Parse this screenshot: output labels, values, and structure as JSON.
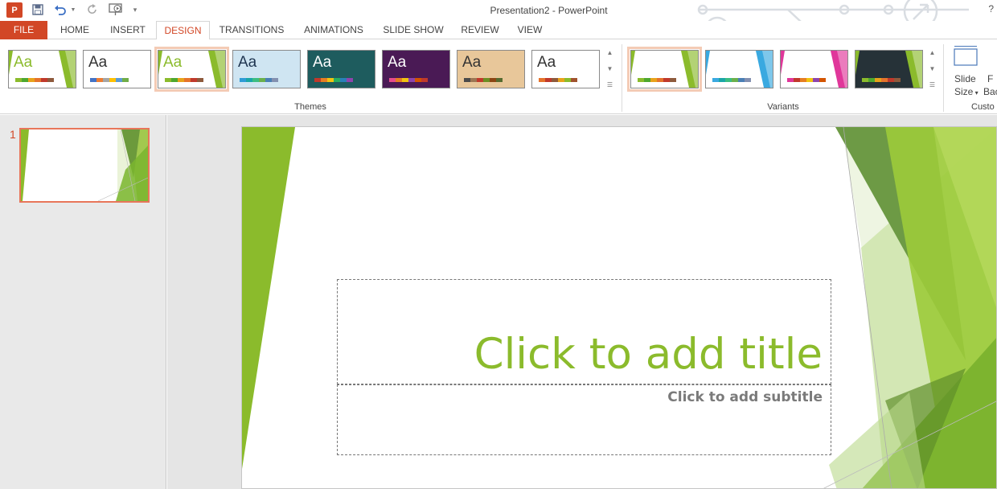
{
  "window": {
    "title": "Presentation2 - PowerPoint",
    "help": "?"
  },
  "qat": {
    "logo": "P"
  },
  "tabs": [
    {
      "label": "FILE"
    },
    {
      "label": "HOME"
    },
    {
      "label": "INSERT"
    },
    {
      "label": "DESIGN"
    },
    {
      "label": "TRANSITIONS"
    },
    {
      "label": "ANIMATIONS"
    },
    {
      "label": "SLIDE SHOW"
    },
    {
      "label": "REVIEW"
    },
    {
      "label": "VIEW"
    }
  ],
  "themes": {
    "label": "Themes",
    "items": [
      {
        "aa": "Aa",
        "aa_color": "#8bbb2c",
        "bg": "#ffffff",
        "accent": "#8bbb2c",
        "bars": [
          "#8bbb2c",
          "#4ea72e",
          "#e8a21a",
          "#e5732b",
          "#c0392b",
          "#8e5a3c"
        ]
      },
      {
        "aa": "Aa",
        "aa_color": "#333333",
        "bg": "#ffffff",
        "accent": "",
        "bars": [
          "#4472c4",
          "#ed7d31",
          "#a5a5a5",
          "#ffc000",
          "#5b9bd5",
          "#70ad47"
        ]
      },
      {
        "aa": "Aa",
        "aa_color": "#8bbb2c",
        "bg": "#ffffff",
        "accent": "#8bbb2c",
        "bars": [
          "#8bbb2c",
          "#4ea72e",
          "#e8a21a",
          "#e5732b",
          "#c0392b",
          "#8e5a3c"
        ]
      },
      {
        "aa": "Aa",
        "aa_color": "#1f3550",
        "bg": "#cfe5f2",
        "accent": "",
        "bars": [
          "#2e9bd6",
          "#1aa6a6",
          "#3cbd82",
          "#6ab04c",
          "#4a7fb5",
          "#8390b0"
        ]
      },
      {
        "aa": "Aa",
        "aa_color": "#ffffff",
        "bg": "#1e5c5e",
        "accent": "",
        "bars": [
          "#c0392b",
          "#e67e22",
          "#f1c40f",
          "#27ae60",
          "#2980b9",
          "#8e44ad"
        ]
      },
      {
        "aa": "Aa",
        "aa_color": "#ffffff",
        "bg": "#4a1a55",
        "accent": "",
        "bars": [
          "#e74c8c",
          "#e67e22",
          "#f1c40f",
          "#8e44ad",
          "#d35400",
          "#c0392b"
        ]
      },
      {
        "aa": "Aa",
        "aa_color": "#333333",
        "bg": "#e8c79a",
        "accent": "",
        "bars": [
          "#4a4a4a",
          "#9b7653",
          "#c0392b",
          "#6b8e23",
          "#8b4513",
          "#556b2f"
        ]
      },
      {
        "aa": "Aa",
        "aa_color": "#333333",
        "bg": "#ffffff",
        "accent": "",
        "bars": [
          "#e5732b",
          "#c0392b",
          "#8e5a3c",
          "#e8a21a",
          "#8bbb2c",
          "#a0522d"
        ]
      }
    ]
  },
  "variants": {
    "label": "Variants",
    "items": [
      {
        "bg": "#ffffff",
        "accent": "#8bbb2c",
        "bars": [
          "#8bbb2c",
          "#4ea72e",
          "#e8a21a",
          "#e5732b",
          "#c0392b",
          "#8e5a3c"
        ]
      },
      {
        "bg": "#ffffff",
        "accent": "#3aa9e0",
        "bars": [
          "#3aa9e0",
          "#1aa6a6",
          "#3cbd82",
          "#6ab04c",
          "#4a7fb5",
          "#8390b0"
        ]
      },
      {
        "bg": "#ffffff",
        "accent": "#e0379a",
        "bars": [
          "#e0379a",
          "#c0392b",
          "#e67e22",
          "#f1c40f",
          "#8e44ad",
          "#d35400"
        ]
      },
      {
        "bg": "#263238",
        "accent": "#8bbb2c",
        "bars": [
          "#8bbb2c",
          "#4ea72e",
          "#e8a21a",
          "#e5732b",
          "#c0392b",
          "#8e5a3c"
        ]
      }
    ]
  },
  "customize": {
    "slide_size_line1": "Slide",
    "slide_size_line2": "Size",
    "format_bg_line1": "F",
    "format_bg_line2": "Bac",
    "group_label": "Custo"
  },
  "slides_pane": {
    "number": "1"
  },
  "slide": {
    "title_placeholder": "Click to add title",
    "subtitle_placeholder": "Click to add subtitle"
  },
  "colors": {
    "accent": "#d24726",
    "theme_green": "#8bbb2c"
  }
}
